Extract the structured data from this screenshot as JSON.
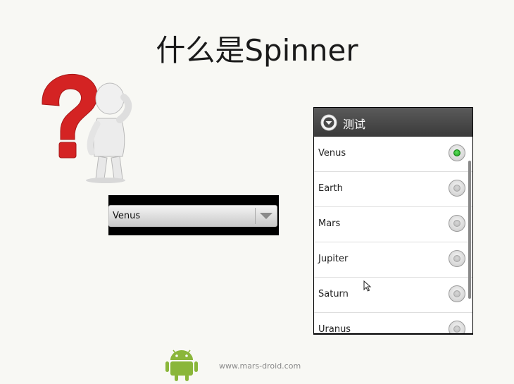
{
  "slide": {
    "title": "什么是Spinner",
    "footer_url": "www.mars-droid.com"
  },
  "spinner": {
    "selected_value": "Venus"
  },
  "dialog": {
    "title": "测试",
    "items": [
      {
        "label": "Venus",
        "checked": true
      },
      {
        "label": "Earth",
        "checked": false
      },
      {
        "label": "Mars",
        "checked": false
      },
      {
        "label": "Jupiter",
        "checked": false
      },
      {
        "label": "Saturn",
        "checked": false
      },
      {
        "label": "Uranus",
        "checked": false
      }
    ]
  },
  "colors": {
    "accent_green": "#1a9a1a",
    "question_mark_red": "#d22020",
    "android_green": "#8ab63a"
  },
  "icons": [
    "question-mark-figure-icon",
    "chevron-down-icon",
    "dialog-arrow-icon",
    "mouse-cursor-icon",
    "android-logo-icon"
  ]
}
